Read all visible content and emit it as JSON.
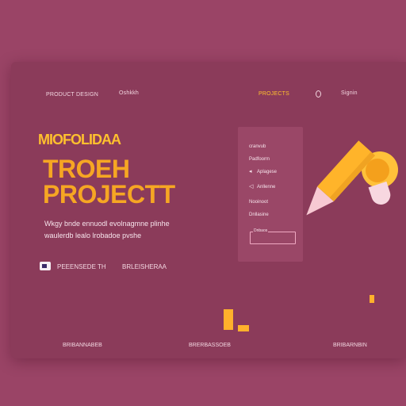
{
  "nav": {
    "left_link": "PRODUCT DESIGN",
    "brand": "Oshkkh",
    "active_link": "PROJECTS",
    "right_link": "Signin"
  },
  "hero": {
    "eyebrow": "MIOFOLIDAA",
    "title_line1": "TROEH",
    "title_line2": "PROJECTT",
    "desc_line1": "Wkgy bnde ennuodl evolnagmne plinhe",
    "desc_line2": "waulerdb lealo lrobadoe pvshe"
  },
  "meta": {
    "left": "PEEENSEDE TH",
    "right": "BRLEISHERAA"
  },
  "menu": {
    "items": [
      "cranvub",
      "Padfoorm",
      "Aplagese",
      "Anllenne",
      "Nooinoot",
      "Dnllasine"
    ],
    "field_label": "Dnbaos"
  },
  "footer": {
    "left": "BRIBANNABEB",
    "center": "BRERBASSOEB",
    "right": "BRIBARNBIN"
  },
  "colors": {
    "background": "#9a4466",
    "panel": "#8b3b5a",
    "accent": "#ffc02e"
  },
  "icons": [
    "search-icon",
    "arrow-icon",
    "lightbulb-icon",
    "pencil-icon"
  ]
}
